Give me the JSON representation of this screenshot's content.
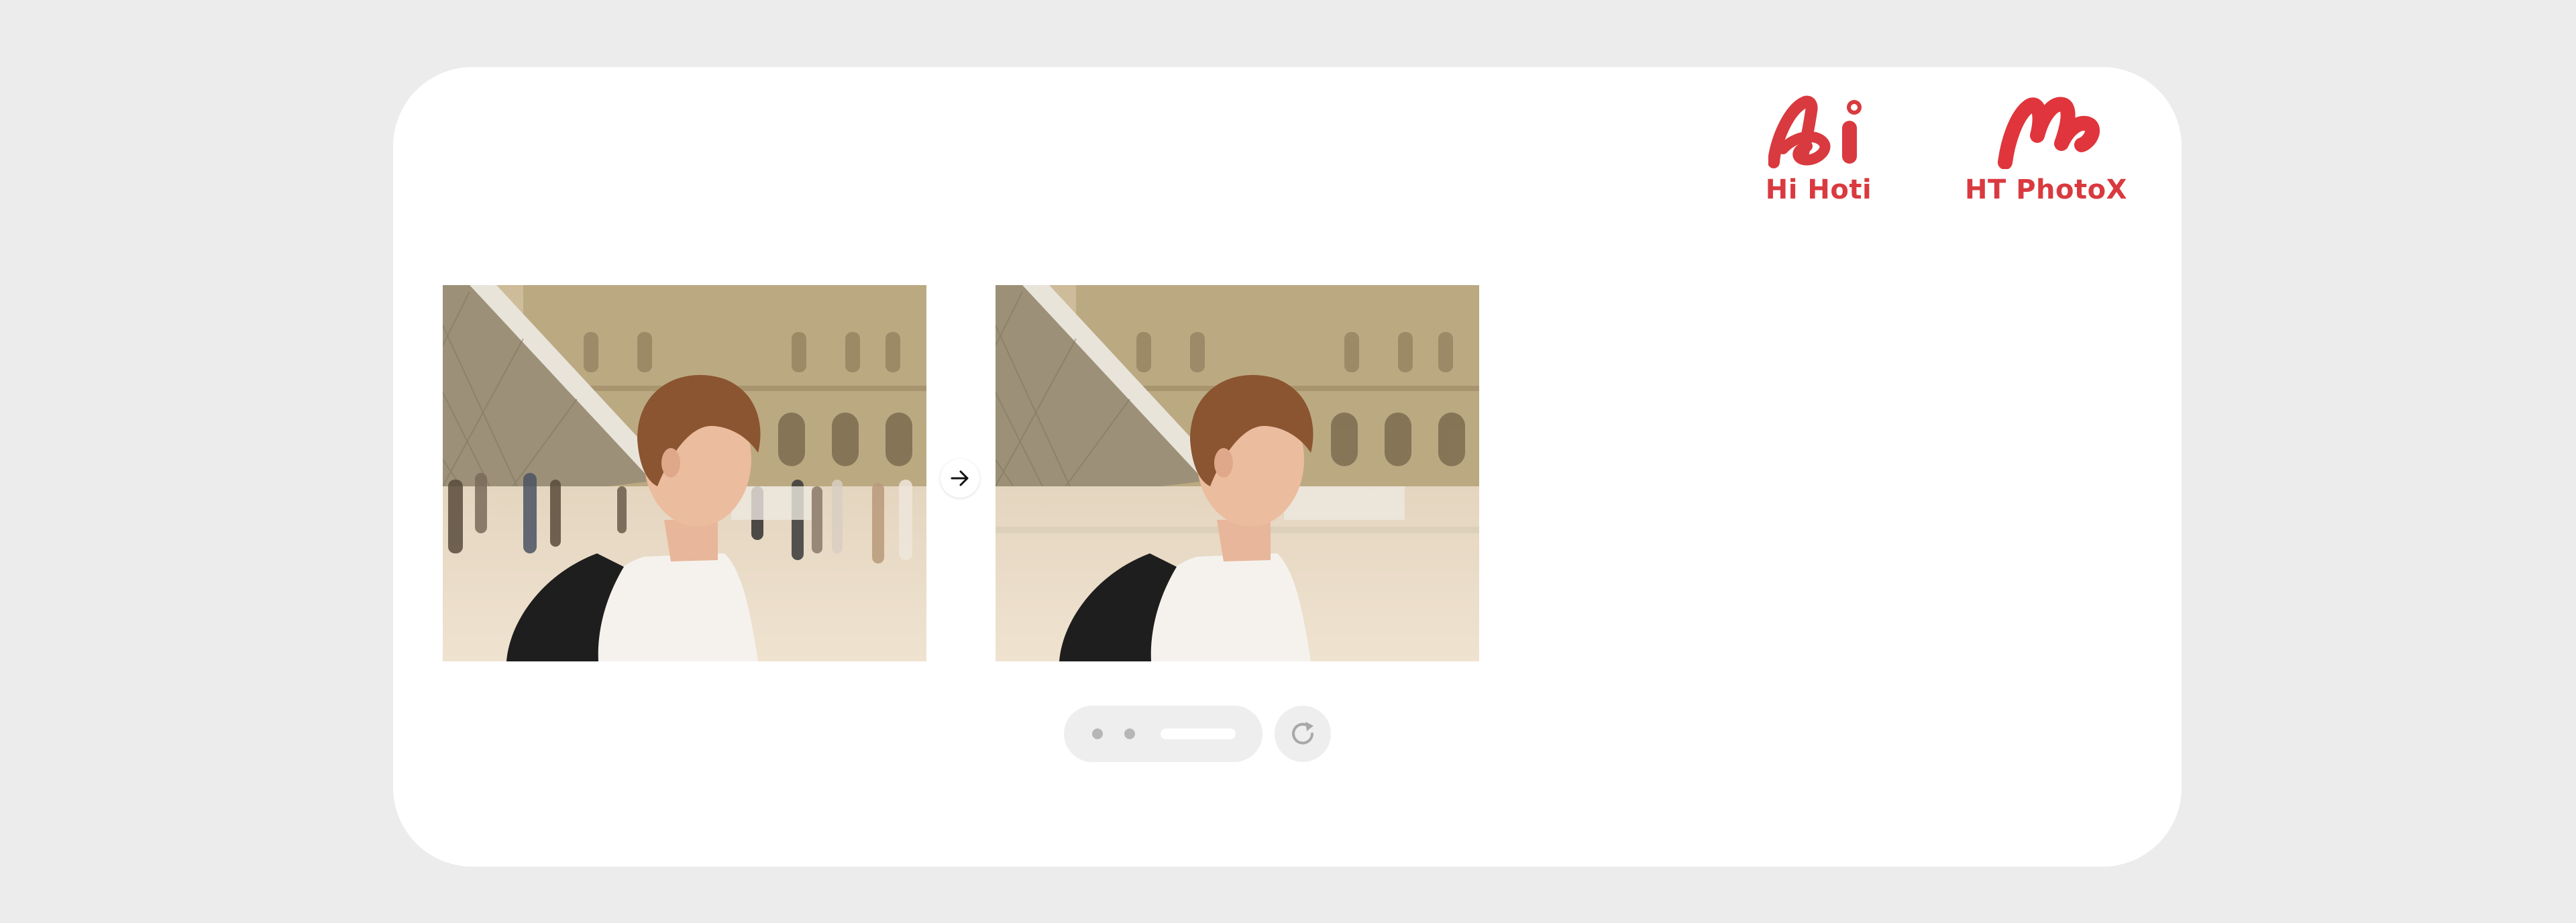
{
  "brands": {
    "hi_hoti": {
      "name": "Hi Hoti",
      "logo_icon": "ai-logo-icon",
      "color": "#d93a3f"
    },
    "ht_photox": {
      "name": "HT PhotoX",
      "logo_icon": "m-logo-icon",
      "color": "#e0353c"
    }
  },
  "comparison": {
    "before_image": "young man with backpack in front of glass pyramid plaza, crowd in background",
    "after_image": "same photo with background people removed",
    "arrow_icon": "arrow-right-icon"
  },
  "pager": {
    "slides": 3,
    "active_index": 2,
    "refresh_icon": "refresh-icon"
  },
  "colors": {
    "background": "#ececec",
    "card": "#ffffff",
    "brand_red": "#d93a3f",
    "control_bg": "#eeeeee",
    "dot_inactive": "#b6b6b6"
  }
}
